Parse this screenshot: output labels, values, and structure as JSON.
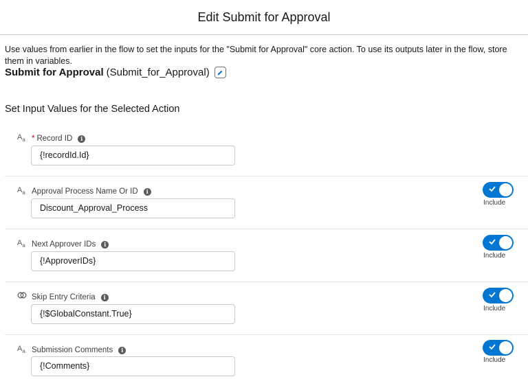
{
  "dialog": {
    "title": "Edit Submit for Approval"
  },
  "intro": {
    "text": "Use values from earlier in the flow to set the inputs for the \"Submit for Approval\" core action. To use its outputs later in the flow, store them in variables."
  },
  "action": {
    "name": "Submit for Approval",
    "api_name": "(Submit_for_Approval)",
    "edit_icon": "pencil-icon"
  },
  "section": {
    "title": "Set Input Values for the Selected Action"
  },
  "fields": [
    {
      "type_icon": "text-type-icon",
      "required_marker": "*",
      "label": "Record ID",
      "value": "{!recordId.Id}",
      "include": null
    },
    {
      "type_icon": "text-type-icon",
      "label": "Approval Process Name Or ID",
      "value": "Discount_Approval_Process",
      "include": true,
      "include_label": "Include"
    },
    {
      "type_icon": "text-type-icon",
      "label": "Next Approver IDs",
      "value": "{!ApproverIDs}",
      "include": true,
      "include_label": "Include"
    },
    {
      "type_icon": "boolean-type-icon",
      "label": "Skip Entry Criteria",
      "value": "{!$GlobalConstant.True}",
      "include": true,
      "include_label": "Include"
    },
    {
      "type_icon": "text-type-icon",
      "label": "Submission Comments",
      "value": "{!Comments}",
      "include": true,
      "include_label": "Include"
    }
  ],
  "colors": {
    "accent": "#0176d3",
    "required": "#ba0517",
    "border": "#c9c9c9"
  }
}
